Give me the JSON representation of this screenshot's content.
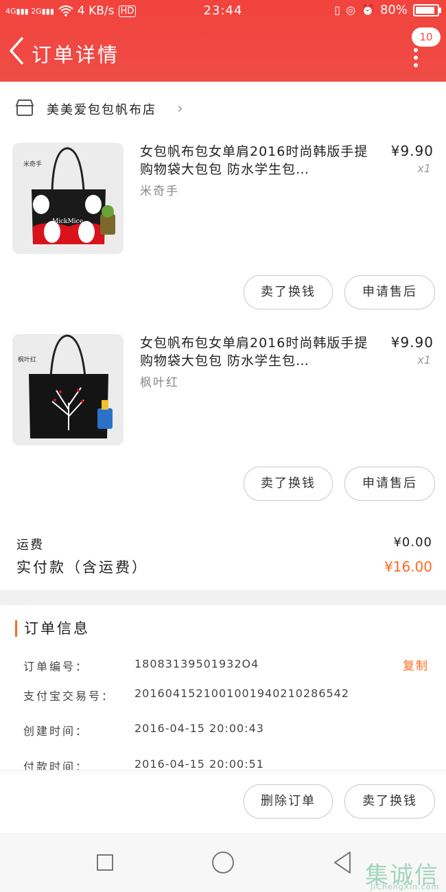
{
  "status_bar": {
    "network": "4G",
    "network2": "2G",
    "speed": "4 KB/s",
    "hd": "HD",
    "time": "23:44",
    "battery": "80%"
  },
  "header": {
    "title": "订单详情",
    "badge_count": "10"
  },
  "shop": {
    "name": "美美爱包包帆布店"
  },
  "items": [
    {
      "title": "女包帆布包女单肩2016时尚韩版手提购物袋大包包 防水学生包…",
      "variant": "米奇手",
      "thumb_label": "米奇手",
      "price": "¥9.90",
      "qty": "x1",
      "actions": [
        "卖了换钱",
        "申请售后"
      ]
    },
    {
      "title": "女包帆布包女单肩2016时尚韩版手提购物袋大包包 防水学生包…",
      "variant": "枫叶红",
      "thumb_label": "枫叶红",
      "price": "¥9.90",
      "qty": "x1",
      "actions": [
        "卖了换钱",
        "申请售后"
      ]
    }
  ],
  "totals": {
    "shipping_label": "运费",
    "shipping_value": "¥0.00",
    "paid_label": "实付款（含运费）",
    "paid_value": "¥16.00"
  },
  "order_info": {
    "title": "订单信息",
    "rows": [
      {
        "label": "订单编号：",
        "value": "18083139501932O4"
      },
      {
        "label": "支付宝交易号：",
        "value": "2016041521001001940210286542"
      },
      {
        "label": "创建时间：",
        "value": "2016-04-15 20:00:43"
      },
      {
        "label": "付款时间：",
        "value": "2016-04-15 20:00:51"
      }
    ],
    "copy_label": "复制"
  },
  "bottom_actions": [
    "删除订单",
    "卖了换钱"
  ],
  "watermark": {
    "text": "集诚信",
    "sub": "JiChengXin.com"
  },
  "colors": {
    "header": "#ef4c46",
    "accent": "#ff6a1a"
  }
}
